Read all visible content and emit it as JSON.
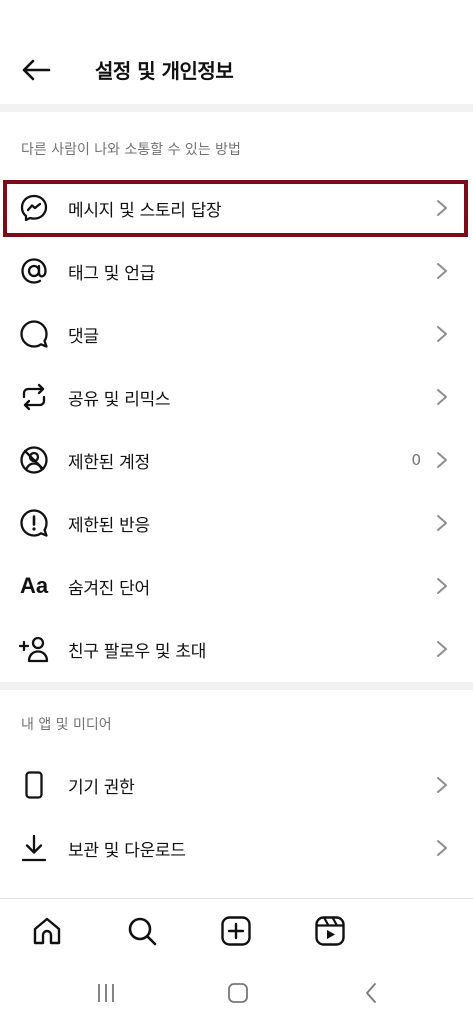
{
  "header": {
    "title": "설정 및 개인정보"
  },
  "sections": [
    {
      "title": "다른 사람이 나와 소통할 수 있는 방법",
      "items": [
        {
          "label": "메시지 및 스토리 답장",
          "icon": "messenger-icon"
        },
        {
          "label": "태그 및 언급",
          "icon": "at-sign-icon"
        },
        {
          "label": "댓글",
          "icon": "comment-icon"
        },
        {
          "label": "공유 및 리믹스",
          "icon": "share-remix-icon"
        },
        {
          "label": "제한된 계정",
          "icon": "restricted-account-icon",
          "count": "0"
        },
        {
          "label": "제한된 반응",
          "icon": "alert-bubble-icon"
        },
        {
          "label": "숨겨진 단어",
          "icon": "hidden-words-icon",
          "glyph": "Aa"
        },
        {
          "label": "친구 팔로우 및 초대",
          "icon": "add-friend-icon"
        }
      ]
    },
    {
      "title": "내 앱 및 미디어",
      "items": [
        {
          "label": "기기 권한",
          "icon": "phone-icon"
        },
        {
          "label": "보관 및 다운로드",
          "icon": "download-icon"
        }
      ]
    }
  ],
  "colors": {
    "highlight": "#7b0c19",
    "secondary_text": "#737373"
  }
}
